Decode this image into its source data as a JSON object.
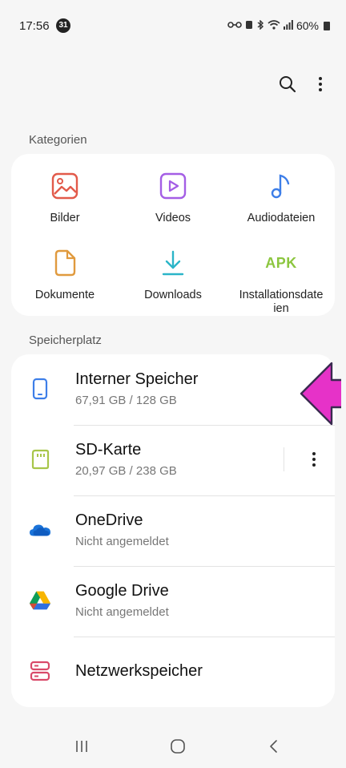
{
  "status": {
    "time": "17:56",
    "notification_count": "31",
    "battery": "60%"
  },
  "categories_label": "Kategorien",
  "categories": [
    {
      "label": "Bilder",
      "icon": "image-icon",
      "color": "#e25a4a"
    },
    {
      "label": "Videos",
      "icon": "video-icon",
      "color": "#a45ee5"
    },
    {
      "label": "Audiodateien",
      "icon": "music-note-icon",
      "color": "#3d7ee8"
    },
    {
      "label": "Dokumente",
      "icon": "document-icon",
      "color": "#e09a3e"
    },
    {
      "label": "Downloads",
      "icon": "download-icon",
      "color": "#2bb5c8"
    },
    {
      "label": "Installationsdateien",
      "label_line1": "Installationsdate",
      "label_line2": "ien",
      "icon": "apk-icon",
      "icon_text": "APK",
      "color": "#8cc63f"
    }
  ],
  "storage_label": "Speicherplatz",
  "storage": [
    {
      "title": "Interner Speicher",
      "subtitle": "67,91 GB / 128 GB",
      "icon": "phone-icon",
      "color": "#3d7ee8"
    },
    {
      "title": "SD-Karte",
      "subtitle": "20,97 GB / 238 GB",
      "icon": "sd-card-icon",
      "color": "#a8c64a"
    },
    {
      "title": "OneDrive",
      "subtitle": "Nicht angemeldet",
      "icon": "onedrive-icon",
      "color": "#1a73d9"
    },
    {
      "title": "Google Drive",
      "subtitle": "Nicht angemeldet",
      "icon": "google-drive-icon",
      "color": "#34a853"
    },
    {
      "title": "Netzwerkspeicher",
      "subtitle": "",
      "icon": "network-storage-icon",
      "color": "#d94a6a"
    }
  ],
  "accent_arrow_color": "#e632c8"
}
